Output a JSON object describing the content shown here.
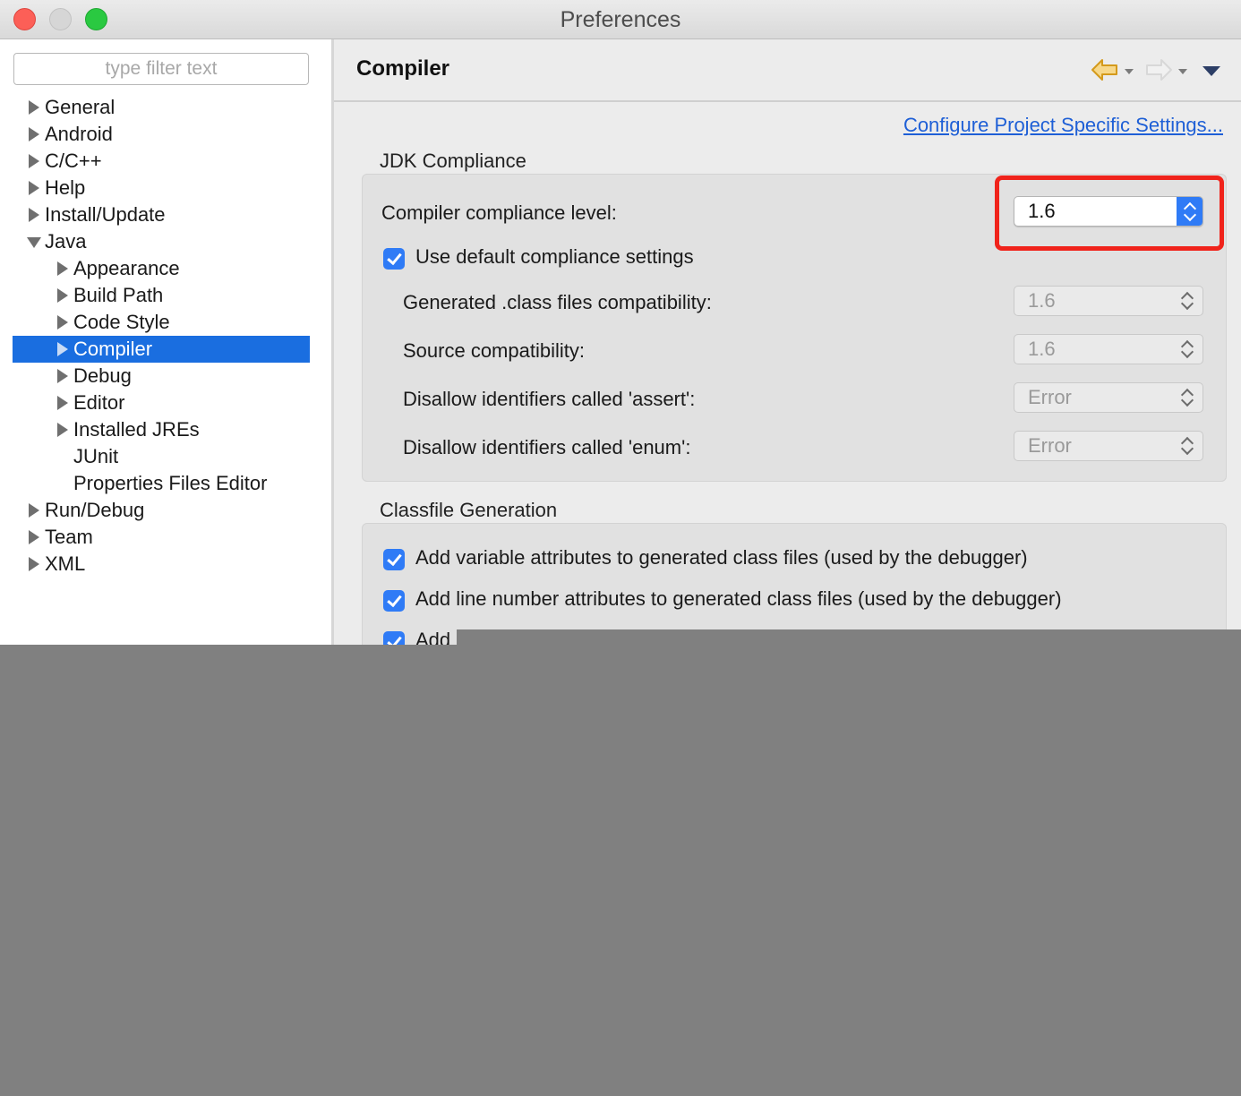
{
  "window": {
    "title": "Preferences"
  },
  "sidebar": {
    "filter_placeholder": "type filter text",
    "items": [
      {
        "label": "General",
        "level": 0,
        "expander": "collapsed"
      },
      {
        "label": "Android",
        "level": 0,
        "expander": "collapsed"
      },
      {
        "label": "C/C++",
        "level": 0,
        "expander": "collapsed"
      },
      {
        "label": "Help",
        "level": 0,
        "expander": "collapsed"
      },
      {
        "label": "Install/Update",
        "level": 0,
        "expander": "collapsed"
      },
      {
        "label": "Java",
        "level": 0,
        "expander": "expanded"
      },
      {
        "label": "Appearance",
        "level": 1,
        "expander": "collapsed"
      },
      {
        "label": "Build Path",
        "level": 1,
        "expander": "collapsed"
      },
      {
        "label": "Code Style",
        "level": 1,
        "expander": "collapsed"
      },
      {
        "label": "Compiler",
        "level": 1,
        "expander": "collapsed",
        "selected": true
      },
      {
        "label": "Debug",
        "level": 1,
        "expander": "collapsed"
      },
      {
        "label": "Editor",
        "level": 1,
        "expander": "collapsed"
      },
      {
        "label": "Installed JREs",
        "level": 1,
        "expander": "collapsed"
      },
      {
        "label": "JUnit",
        "level": 1,
        "expander": "none"
      },
      {
        "label": "Properties Files Editor",
        "level": 1,
        "expander": "none"
      },
      {
        "label": "Run/Debug",
        "level": 0,
        "expander": "collapsed"
      },
      {
        "label": "Team",
        "level": 0,
        "expander": "collapsed"
      },
      {
        "label": "XML",
        "level": 0,
        "expander": "collapsed"
      }
    ]
  },
  "page": {
    "title": "Compiler",
    "configure_link": "Configure Project Specific Settings...",
    "jdk_section": {
      "title": "JDK Compliance",
      "compliance_label": "Compiler compliance level:",
      "compliance_value": "1.6",
      "use_default_label": "Use default compliance settings",
      "use_default_checked": true,
      "generated_label": "Generated .class files compatibility:",
      "generated_value": "1.6",
      "source_label": "Source compatibility:",
      "source_value": "1.6",
      "assert_label": "Disallow identifiers called 'assert':",
      "assert_value": "Error",
      "enum_label": "Disallow identifiers called 'enum':",
      "enum_value": "Error"
    },
    "classfile_section": {
      "title": "Classfile Generation",
      "options": [
        {
          "label": "Add variable attributes to generated class files (used by the debugger)",
          "checked": true
        },
        {
          "label": "Add line number attributes to generated class files (used by the debugger)",
          "checked": true
        },
        {
          "label": "Add",
          "checked": true
        }
      ]
    }
  },
  "colors": {
    "selection": "#1a6ee0",
    "checkbox": "#2f7bf6",
    "highlight_box": "#f0231b",
    "link": "#1e5fd6",
    "backdrop": "#808080"
  },
  "icons": [
    "back-arrow-icon",
    "forward-arrow-icon",
    "view-menu-icon"
  ]
}
